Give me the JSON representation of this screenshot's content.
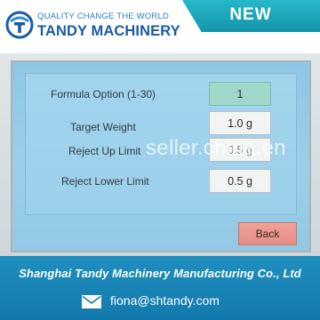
{
  "header": {
    "tagline": "QUALITY CHANGE THE WORLD",
    "brand": "TANDY MACHINERY",
    "badge": "NEW",
    "brand_color": "#1a5aa8",
    "badge_color": "#1ca6ba",
    "logo_icon": "tandy-logo-icon"
  },
  "screen": {
    "rows": [
      {
        "label": "Formula Option  (1-30)",
        "value": "1"
      },
      {
        "label": "Target Weight",
        "value": "1.0 g"
      },
      {
        "label": "Reject Up Limit",
        "value": "0.5 g"
      },
      {
        "label": "Reject Lower Limit",
        "value": "0.5 g"
      }
    ],
    "back_label": "Back",
    "watermark": "seller.china.en"
  },
  "footer": {
    "company": "Shanghai Tandy Machinery Manufacturing Co., Ltd",
    "email": "fiona@shtandy.com",
    "email_icon": "envelope-icon"
  }
}
